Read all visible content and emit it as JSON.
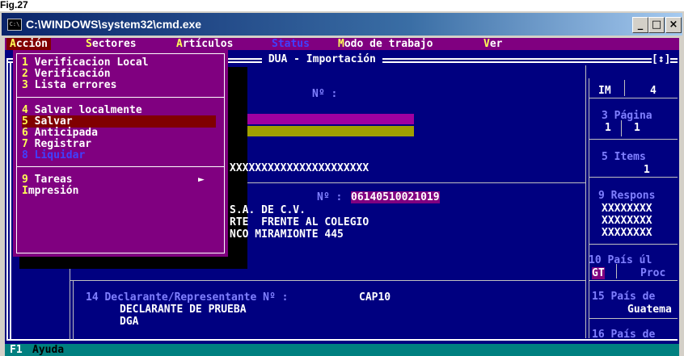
{
  "figure_label": "Fig.27",
  "window": {
    "title": "C:\\WINDOWS\\system32\\cmd.exe",
    "icon_text": "C:\\",
    "btn_min": "_",
    "btn_max": "□",
    "btn_close": "×"
  },
  "menu": {
    "items": [
      {
        "hot": "A",
        "rest": "cción"
      },
      {
        "hot": "S",
        "rest": "ectores"
      },
      {
        "hot": "A",
        "rest": "rtículos"
      },
      {
        "hot": "",
        "rest": "Status"
      },
      {
        "hot": "M",
        "rest": "odo de trabajo"
      },
      {
        "hot": "V",
        "rest": "er"
      }
    ]
  },
  "dropdown": {
    "items": [
      {
        "num": "1",
        "label": " Verificacion Local"
      },
      {
        "num": "2",
        "label": " Verificación"
      },
      {
        "num": "3",
        "label": " Lista errores"
      },
      {
        "num": "4",
        "label": " Salvar localmente"
      },
      {
        "num": "5",
        "label": " Salvar"
      },
      {
        "num": "6",
        "label": " Anticipada"
      },
      {
        "num": "7",
        "label": " Registrar"
      },
      {
        "num": "8",
        "label": " Liquidar"
      },
      {
        "num": "9",
        "label": " Tareas"
      },
      {
        "num": "I",
        "label": "mpresión"
      }
    ],
    "submenu_arrow": "►"
  },
  "form": {
    "title": " DUA - Importación ",
    "resize_marker": "[↕]",
    "no_label_1": "Nº :",
    "xxx_line": "XXXXXXXXXXXXXXXXXXXXXX",
    "no_label_2": "Nº :",
    "no_value_2": "06140510021019",
    "company_1": "S.A. DE C.V.",
    "company_2": "RTE  FRENTE AL COLEGIO",
    "company_3": "NCO MIRAMIONTE 445",
    "declarante_label": "14 Declarante/Representante Nº :",
    "declarante_code": "CAP10",
    "declarante_name": "DECLARANTE DE PRUEBA",
    "declarante_sub": "DGA"
  },
  "side": {
    "im_label": "IM",
    "im_value": "4",
    "pagina_label": "3 Página",
    "pagina_val1": "1",
    "pagina_val2": "1",
    "items_label": "5 Items",
    "items_value": "1",
    "respons_label": "9 Respons",
    "respons_val": "XXXXXXXX",
    "pais_ul_label": "10 País úl",
    "gt": "GT",
    "proc": "Proc",
    "pais_de_label": "15 País de",
    "guatema": "Guatema",
    "pais_de_label2": "16 País de"
  },
  "statusbar": {
    "key": "F1",
    "label": "Ayuda"
  },
  "colors": {
    "console_bg": "#000080",
    "menu_bg": "#800080",
    "highlight": "#800000",
    "hotkey": "#ffff55",
    "statusbar": "#008080"
  }
}
